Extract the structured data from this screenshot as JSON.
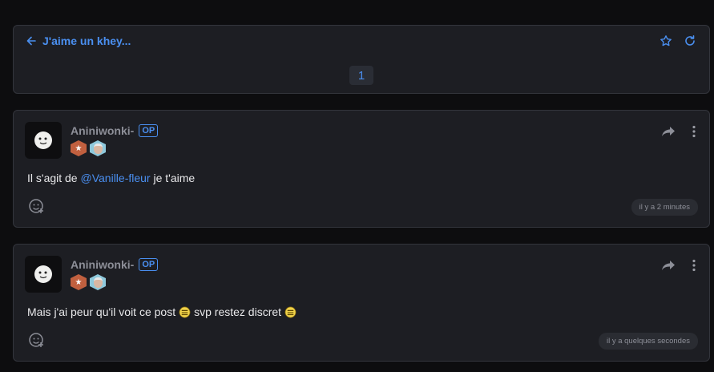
{
  "topic": {
    "title": "J'aime un khey...",
    "current_page": "1"
  },
  "posts": [
    {
      "author": "Aniniwonki-",
      "op_label": "OP",
      "content_prefix": "Il s'agit de ",
      "mention": "@Vanille-fleur",
      "content_suffix": " je t'aime",
      "timestamp": "il y a 2 minutes"
    },
    {
      "author": "Aniniwonki-",
      "op_label": "OP",
      "content_part1": "Mais j'ai peur qu'il voit ce post",
      "content_part2": "svp restez discret",
      "timestamp": "il y a quelques secondes"
    }
  ],
  "icons": {
    "back": "arrow-left-icon",
    "favorite": "star-icon",
    "refresh": "refresh-icon",
    "share": "share-arrow-icon",
    "more": "more-vertical-icon",
    "react": "add-reaction-icon",
    "emoji": "nervous-smiley-icon"
  },
  "colors": {
    "accent": "#4a8ff0",
    "card_bg": "#1d1e23",
    "page_bg": "#0d0d0f",
    "badge_orange": "#c1603f"
  }
}
